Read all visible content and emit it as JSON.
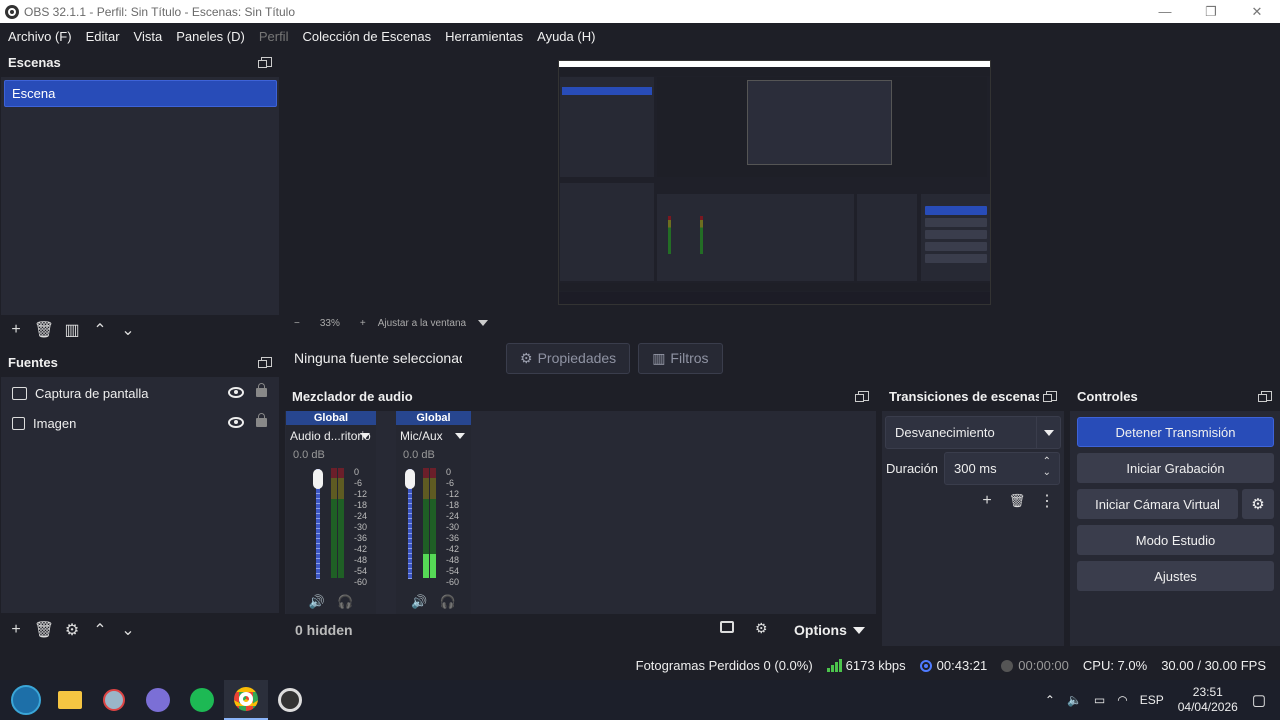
{
  "window": {
    "title": "OBS 32.1.1 - Perfil: Sin Título - Escenas: Sin Título",
    "minimize": "—",
    "maximize": "❐",
    "close": "✕"
  },
  "menu": {
    "items": [
      "Archivo (F)",
      "Editar",
      "Vista",
      "Paneles (D)",
      "Perfil",
      "Colección de Escenas",
      "Herramientas",
      "Ayuda (H)"
    ]
  },
  "scenes": {
    "title": "Escenas",
    "items": [
      "Escena"
    ]
  },
  "sources": {
    "title": "Fuentes",
    "items": [
      {
        "label": "Captura de pantalla",
        "icon": "monitor-icon"
      },
      {
        "label": "Imagen",
        "icon": "image-icon"
      }
    ]
  },
  "preview": {
    "zoom": "33%",
    "zoom_mode": "Ajustar a la ventana",
    "zoom_minus": "−",
    "zoom_plus": "+"
  },
  "context": {
    "no_source": "Ninguna fuente seleccionada",
    "properties": "Propiedades",
    "filters": "Filtros"
  },
  "mixer": {
    "title": "Mezclador de audio",
    "channels": [
      {
        "head": "Global",
        "name": "Audio d...ritorio",
        "db": "0.0 dB",
        "level": 0
      },
      {
        "head": "Global",
        "name": "Mic/Aux",
        "db": "0.0 dB",
        "level": 0.22
      }
    ],
    "scale": [
      "0",
      "-6",
      "-12",
      "-18",
      "-24",
      "-30",
      "-36",
      "-42",
      "-48",
      "-54",
      "-60"
    ],
    "hidden": "0 hidden",
    "options": "Options"
  },
  "transitions": {
    "title": "Transiciones de escenas",
    "selected": "Desvanecimiento",
    "duration_label": "Duración",
    "duration_value": "300 ms"
  },
  "controls": {
    "title": "Controles",
    "stop_stream": "Detener Transmisión",
    "start_record": "Iniciar Grabación",
    "start_virtualcam": "Iniciar Cámara Virtual",
    "studio_mode": "Modo Estudio",
    "settings": "Ajustes"
  },
  "status": {
    "dropped": "Fotogramas Perdidos 0 (0.0%)",
    "bitrate": "6173 kbps",
    "stream_time": "00:43:21",
    "rec_time": "00:00:00",
    "cpu": "CPU: 7.0%",
    "fps": "30.00 / 30.00 FPS"
  },
  "taskbar": {
    "lang": "ESP",
    "time": "23:51",
    "date": "04/04/2026"
  },
  "colors": {
    "accent": "#284cb8",
    "panel": "#272934",
    "background": "#1e1f27"
  }
}
